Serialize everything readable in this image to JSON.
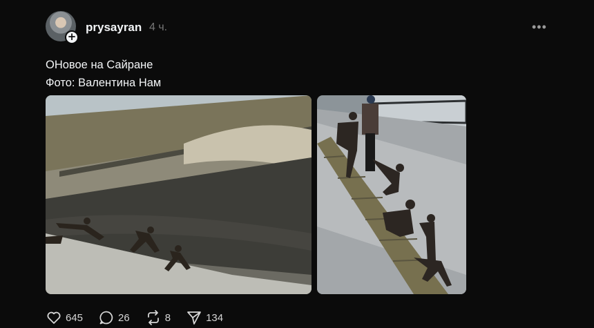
{
  "post": {
    "username": "prysayran",
    "time": "4 ч.",
    "more_icon": "•••",
    "text_line1": "ОНовое на Сайране",
    "text_line2": "Фото: Валентина Нам",
    "avatar_plus": "+"
  },
  "actions": {
    "likes": "645",
    "comments": "26",
    "reposts": "8",
    "shares": "134"
  },
  "colors": {
    "background": "#0b0b0b",
    "text": "#f3f5f7",
    "muted": "#777777"
  }
}
